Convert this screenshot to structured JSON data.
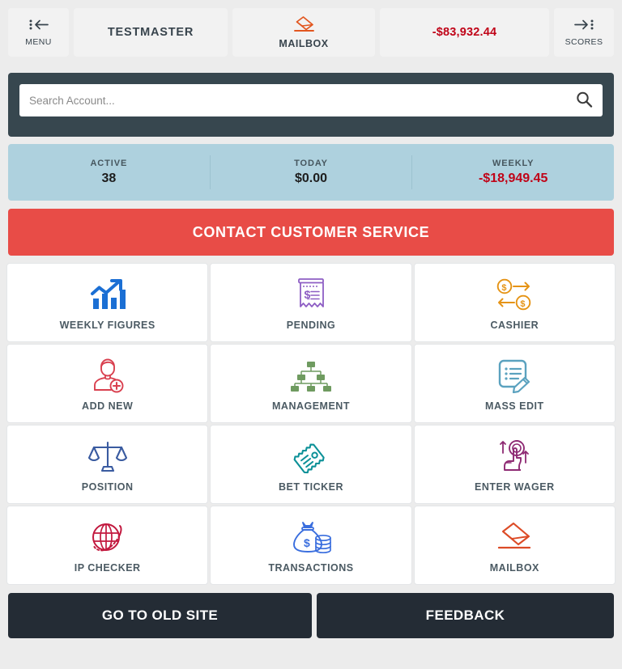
{
  "topnav": {
    "menu": {
      "label": "MENU",
      "icon": "menu-arrow-left-icon"
    },
    "title": "TESTMASTER",
    "mailbox": {
      "label": "MAILBOX",
      "icon": "mailbox-envelope-icon",
      "color": "#e2561f"
    },
    "balance": {
      "value": "-$83,932.44",
      "color": "#c00418"
    },
    "scores": {
      "label": "SCORES",
      "icon": "scores-arrow-right-icon"
    }
  },
  "search": {
    "placeholder": "Search Account...",
    "value": "",
    "icon": "search-icon",
    "panel_color": "#37474f"
  },
  "stats": {
    "items": [
      {
        "label": "ACTIVE",
        "value": "38",
        "negative": false
      },
      {
        "label": "TODAY",
        "value": "$0.00",
        "negative": false
      },
      {
        "label": "WEEKLY",
        "value": "-$18,949.45",
        "negative": true
      }
    ],
    "background": "#aed1de"
  },
  "contact": {
    "label": "CONTACT CUSTOMER SERVICE",
    "color": "#e84c47"
  },
  "tiles": [
    {
      "label": "WEEKLY FIGURES",
      "icon": "bar-chart-growth-icon",
      "color": "#1b6fd4"
    },
    {
      "label": "PENDING",
      "icon": "receipt-dollar-icon",
      "color": "#8e5ec4"
    },
    {
      "label": "CASHIER",
      "icon": "coin-exchange-icon",
      "color": "#e59314"
    },
    {
      "label": "ADD NEW",
      "icon": "user-add-icon",
      "color": "#d9404f"
    },
    {
      "label": "MANAGEMENT",
      "icon": "org-chart-icon",
      "color": "#6f9b60"
    },
    {
      "label": "MASS EDIT",
      "icon": "list-pencil-icon",
      "color": "#5ba2bf"
    },
    {
      "label": "POSITION",
      "icon": "balance-scales-icon",
      "color": "#3a5ba0"
    },
    {
      "label": "BET TICKER",
      "icon": "ticket-icon",
      "color": "#0d9198"
    },
    {
      "label": "ENTER WAGER",
      "icon": "hand-coin-icon",
      "color": "#8e2a73"
    },
    {
      "label": "IP CHECKER",
      "icon": "globe-orbit-icon",
      "color": "#c2193f"
    },
    {
      "label": "TRANSACTIONS",
      "icon": "money-bag-coins-icon",
      "color": "#3a6ede"
    },
    {
      "label": "MAILBOX",
      "icon": "mailbox-envelope-icon",
      "color": "#dc4b26"
    }
  ],
  "footer": {
    "old_site": "GO TO OLD SITE",
    "feedback": "FEEDBACK"
  }
}
